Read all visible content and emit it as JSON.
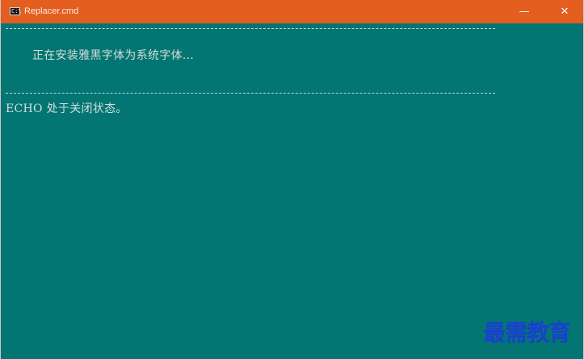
{
  "window": {
    "title": "Replacer.cmd",
    "icon": "console-icon",
    "icon_glyph": "C:\\",
    "minimize_glyph": "—",
    "close_glyph": "✕",
    "colors": {
      "titlebar": "#e35e1f",
      "console_bg": "#037572",
      "console_text": "#d4dedd"
    }
  },
  "console": {
    "install_message": "正在安装雅黑字体为系统字体...",
    "echo_message": "ECHO 处于关闭状态。"
  },
  "watermark": {
    "text": "最需教育",
    "color": "#1a3fd1"
  }
}
